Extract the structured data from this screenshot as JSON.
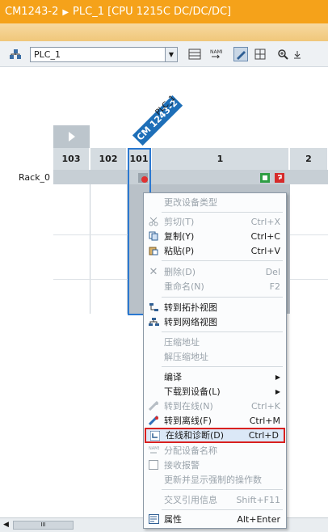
{
  "title": {
    "module": "CM1243-2",
    "sep": "▶",
    "device": "PLC_1 [CPU 1215C DC/DC/DC]"
  },
  "toolbar": {
    "device_select": "PLC_1",
    "icons": [
      "network-icon",
      "dropdown-icon",
      "table-icon",
      "name-icon",
      "edit-icon",
      "grid-icon",
      "zoom-icon",
      "pin-icon"
    ]
  },
  "rack": {
    "name": "Rack_0",
    "slots": [
      "103",
      "102",
      "101",
      "1",
      "2"
    ],
    "module_tag": "CM 1243-2",
    "module_sub": "PLC_1"
  },
  "context_menu": {
    "items": [
      {
        "label": "更改设备类型",
        "shortcut": "",
        "enabled": false,
        "icon": ""
      },
      {
        "label": "剪切(T)",
        "shortcut": "Ctrl+X",
        "enabled": false,
        "icon": "cut-icon"
      },
      {
        "label": "复制(Y)",
        "shortcut": "Ctrl+C",
        "enabled": true,
        "icon": "copy-icon"
      },
      {
        "label": "粘贴(P)",
        "shortcut": "Ctrl+V",
        "enabled": true,
        "icon": "paste-icon"
      },
      {
        "label": "删除(D)",
        "shortcut": "Del",
        "enabled": false,
        "icon": "delete-icon"
      },
      {
        "label": "重命名(N)",
        "shortcut": "F2",
        "enabled": false,
        "icon": ""
      },
      {
        "label": "转到拓扑视图",
        "shortcut": "",
        "enabled": true,
        "icon": "topology-icon"
      },
      {
        "label": "转到网络视图",
        "shortcut": "",
        "enabled": true,
        "icon": "network-view-icon"
      },
      {
        "label": "压缩地址",
        "shortcut": "",
        "enabled": false,
        "icon": ""
      },
      {
        "label": "解压缩地址",
        "shortcut": "",
        "enabled": false,
        "icon": ""
      },
      {
        "label": "编译",
        "shortcut": "",
        "enabled": true,
        "icon": "",
        "submenu": true
      },
      {
        "label": "下载到设备(L)",
        "shortcut": "",
        "enabled": true,
        "icon": "",
        "submenu": true
      },
      {
        "label": "转到在线(N)",
        "shortcut": "Ctrl+K",
        "enabled": false,
        "icon": "go-online-icon"
      },
      {
        "label": "转到离线(F)",
        "shortcut": "Ctrl+M",
        "enabled": true,
        "icon": "go-offline-icon"
      },
      {
        "label": "在线和诊断(D)",
        "shortcut": "Ctrl+D",
        "enabled": true,
        "icon": "diagnostics-icon",
        "highlighted": true
      },
      {
        "label": "分配设备名称",
        "shortcut": "",
        "enabled": false,
        "icon": "assign-name-icon"
      },
      {
        "label": "接收报警",
        "shortcut": "",
        "enabled": false,
        "icon": "alarm-checkbox-icon"
      },
      {
        "label": "更新并显示强制的操作数",
        "shortcut": "",
        "enabled": false,
        "icon": ""
      },
      {
        "label": "交叉引用信息",
        "shortcut": "Shift+F11",
        "enabled": false,
        "icon": ""
      },
      {
        "label": "属性",
        "shortcut": "Alt+Enter",
        "enabled": true,
        "icon": "properties-icon"
      }
    ]
  },
  "scrollbar": {
    "thumb_label": "III"
  },
  "colors": {
    "accent": "#f5a21a",
    "selection": "#2b78d0",
    "highlight_border": "#d9201f"
  }
}
